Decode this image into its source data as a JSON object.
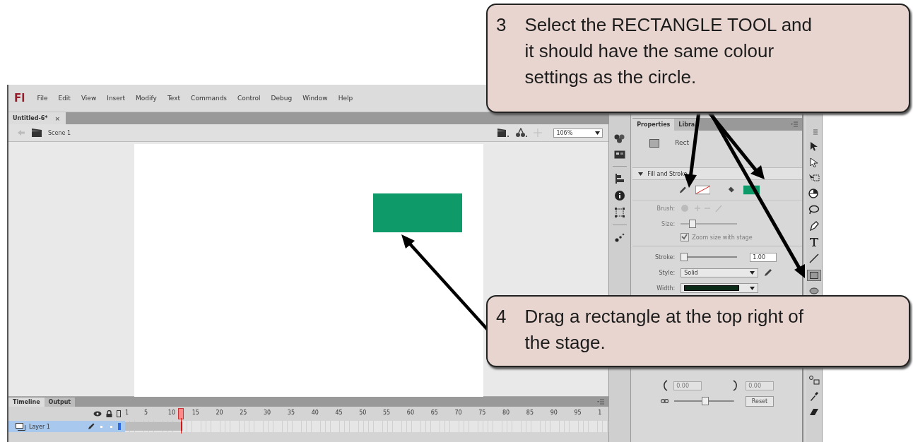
{
  "menu_bar": {
    "logo": "Fl",
    "items": [
      "File",
      "Edit",
      "View",
      "Insert",
      "Modify",
      "Text",
      "Commands",
      "Control",
      "Debug",
      "Window",
      "Help"
    ]
  },
  "document_tabs": [
    {
      "label": "Untitled-6*",
      "selected": true,
      "close": "×"
    }
  ],
  "edit_bar": {
    "scene": "Scene 1",
    "zoom": "106%"
  },
  "properties_panel": {
    "tabs": [
      {
        "label": "Properties",
        "selected": true
      },
      {
        "label": "Libra",
        "selected": false
      }
    ],
    "tool_name": "Rect",
    "section": "Fill and Stroke",
    "brush_label": "Brush:",
    "size_label": "Size:",
    "size_slider": {
      "level": 0.2
    },
    "zoom_option": {
      "label": "Zoom size with stage",
      "checked": true,
      "disabled": true
    },
    "stroke": {
      "label": "Stroke:",
      "level": 0.05,
      "value": "1.00"
    },
    "style": {
      "label": "Style:",
      "value": "Solid"
    },
    "width_label": "Width:",
    "corner_values": [
      "0.00",
      "0.00"
    ],
    "corner_slider": {
      "level": 0.5
    },
    "reset": "Reset"
  },
  "timeline": {
    "tabs": [
      {
        "label": "Timeline",
        "selected": true
      },
      {
        "label": "Output",
        "selected": false
      }
    ],
    "frame_numbers": [
      "1",
      "5",
      "10",
      "15",
      "20",
      "25",
      "30",
      "35",
      "40",
      "45",
      "50",
      "55",
      "60",
      "65",
      "70",
      "75",
      "80",
      "85",
      "90",
      "95",
      "1"
    ],
    "layers": [
      {
        "name": "Layer 1",
        "selected": true
      }
    ]
  },
  "callouts": [
    {
      "number": "3",
      "lines": [
        "Select the RECTANGLE TOOL and",
        "it should have the same colour",
        "settings as the circle."
      ]
    },
    {
      "number": "4",
      "lines": [
        "Drag a rectangle at the top right of",
        "the stage."
      ]
    }
  ]
}
